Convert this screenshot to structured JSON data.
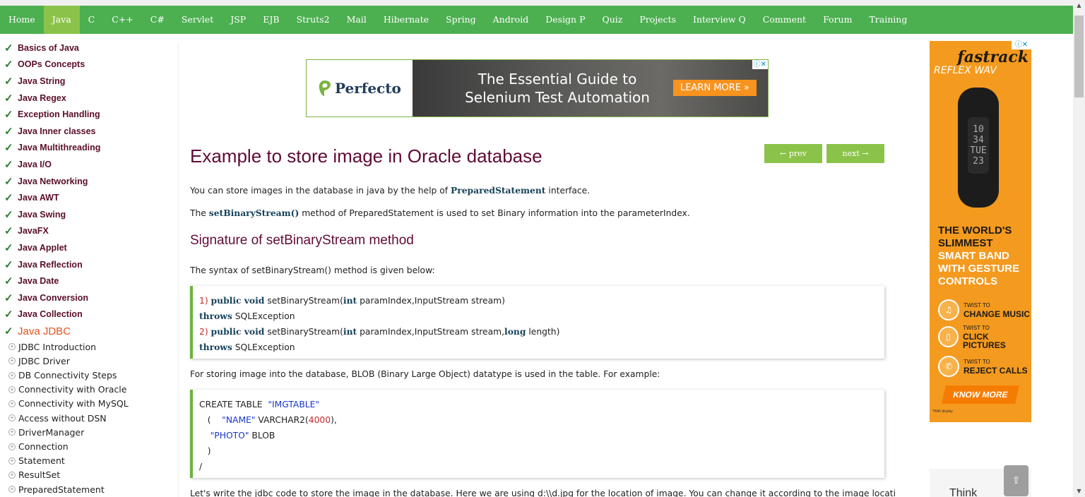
{
  "nav": {
    "items": [
      "Home",
      "Java",
      "C",
      "C++",
      "C#",
      "Servlet",
      "JSP",
      "EJB",
      "Struts2",
      "Mail",
      "Hibernate",
      "Spring",
      "Android",
      "Design P",
      "Quiz",
      "Projects",
      "Interview Q",
      "Comment",
      "Forum",
      "Training"
    ],
    "active": "Java",
    "color": "#4caf50",
    "active_color": "#8bc34a"
  },
  "sidebar": {
    "topics": [
      "Basics of Java",
      "OOPs Concepts",
      "Java String",
      "Java Regex",
      "Exception Handling",
      "Java Inner classes",
      "Java Multithreading",
      "Java I/O",
      "Java Networking",
      "Java AWT",
      "Java Swing",
      "JavaFX",
      "Java Applet",
      "Java Reflection",
      "Java Date",
      "Java Conversion",
      "Java Collection"
    ],
    "active_topic": "Java JDBC",
    "subtopics": [
      "JDBC Introduction",
      "JDBC Driver",
      "DB Connectivity Steps",
      "Connectivity with Oracle",
      "Connectivity with MySQL",
      "Access without DSN",
      "DriverManager",
      "Connection",
      "Statement",
      "ResultSet",
      "PreparedStatement"
    ],
    "check_icon": "check-icon",
    "expand_icon": "plus-circle-icon"
  },
  "ad_banner": {
    "brand": "Perfecto",
    "headline_line1": "The Essential Guide to",
    "headline_line2": "Selenium Test Automation",
    "cta": "LEARN MORE »",
    "adchoice": "ⓘ✕"
  },
  "article": {
    "title": "Example to store image in Oracle database",
    "prev_label": "← prev",
    "next_label": "next →",
    "p1_pre": "You can store images in the database in java by the help of ",
    "p1_bold": "PreparedStatement",
    "p1_post": " interface.",
    "p2_pre": "The ",
    "p2_bold": "setBinaryStream()",
    "p2_post": " method of PreparedStatement is used to set Binary information into the parameterIndex.",
    "subtitle": "Signature of setBinaryStream method",
    "p3": "The syntax of setBinaryStream() method is given below:",
    "sig": {
      "l1_num": "1) ",
      "l1_kw1": "public void",
      "l1_mid": " setBinaryStream(",
      "l1_kw2": "int",
      "l1_rest": " paramIndex,InputStream stream)",
      "l2_kw": "throws",
      "l2_rest": " SQLException",
      "l3_num": "2) ",
      "l3_kw1": "public void",
      "l3_mid": " setBinaryStream(",
      "l3_kw2": "int",
      "l3_mid2": " paramIndex,InputStream stream,",
      "l3_kw3": "long",
      "l3_rest": " length)",
      "l4_kw": "throws",
      "l4_rest": " SQLException"
    },
    "p4": "For storing image into the database, BLOB (Binary Large Object) datatype is used in the table. For example:",
    "sql": {
      "l1_pre": "CREATE TABLE  ",
      "l1_str": "\"IMGTABLE\"",
      "l2_pre": "   (    ",
      "l2_str": "\"NAME\"",
      "l2_mid": " VARCHAR2(",
      "l2_num": "4000",
      "l2_post": "),",
      "l3_pre": "    ",
      "l3_str": "\"PHOTO\"",
      "l3_post": " BLOB",
      "l4": "   )",
      "l5": "/"
    },
    "p5": "Let's write the jdbc code to store the image in the database. Here we are using d:\\\\d.jpg for the location of image. You can change it according to the image location."
  },
  "right_ad": {
    "brand": "fastrack",
    "sub": "REFLEX WAV",
    "screen": "10 34 TUE 23",
    "headline_dark": "THE WORLD'S SLIMMEST",
    "headline_light": "SMART BAND WITH GESTURE CONTROLS",
    "features": [
      {
        "small": "TWIST TO",
        "large": "CHANGE MUSIC",
        "icon": "music-icon"
      },
      {
        "small": "TWIST TO",
        "large": "CLICK PICTURES",
        "icon": "camera-icon"
      },
      {
        "small": "TWIST TO",
        "large": "REJECT CALLS",
        "icon": "phone-icon"
      }
    ],
    "cta": "KNOW MORE",
    "fine": "*With display",
    "choice": "ⓘ✕",
    "bg_color": "#f49a1f"
  },
  "right_ad2": {
    "text": "Think"
  },
  "scroll_top": {
    "label": "⇧"
  },
  "colors": {
    "title": "#610b38",
    "keyword": "#16425b",
    "code_border": "#6cb33e",
    "active_topic": "#e8531a"
  }
}
